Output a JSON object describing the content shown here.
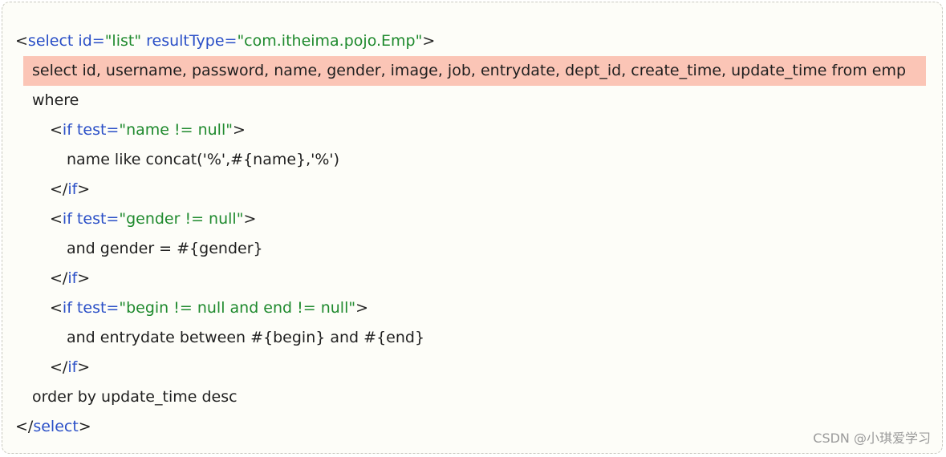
{
  "code": {
    "l1": {
      "open": "<",
      "tag": "select",
      "attr1": " id=",
      "val1": "\"list\"",
      "attr2": " resultType=",
      "val2": "\"com.itheima.pojo.Emp\"",
      "close": ">"
    },
    "l2": {
      "text": "select id, username, password, name, gender, image, job, entrydate, dept_id, create_time, update_time from emp"
    },
    "l3": {
      "text": "where"
    },
    "l4": {
      "open": "<",
      "tag": "if",
      "attr": " test=",
      "val": "\"name != null\"",
      "close": ">"
    },
    "l5": {
      "text": "name like concat('%',#{name},'%')"
    },
    "l6": {
      "open": "</",
      "tag": "if",
      "close": ">"
    },
    "l7": {
      "open": "<",
      "tag": "if",
      "attr": " test=",
      "val": "\"gender != null\"",
      "close": ">"
    },
    "l8": {
      "text": "and gender = #{gender}"
    },
    "l9": {
      "open": "</",
      "tag": "if",
      "close": ">"
    },
    "l10": {
      "open": "<",
      "tag": "if",
      "attr": " test=",
      "val": "\"begin != null and end != null\"",
      "close": ">"
    },
    "l11": {
      "text": "and entrydate between #{begin} and #{end}"
    },
    "l12": {
      "open": "</",
      "tag": "if",
      "close": ">"
    },
    "l13": {
      "text": "order by update_time desc"
    },
    "l14": {
      "open": "</",
      "tag": "select",
      "close": ">"
    }
  },
  "watermark": "CSDN @小琪爱学习",
  "colors": {
    "tag": "#2a4fc7",
    "string": "#1f8a2e",
    "text": "#1f1f1f",
    "highlight": "#fbc5b6"
  }
}
